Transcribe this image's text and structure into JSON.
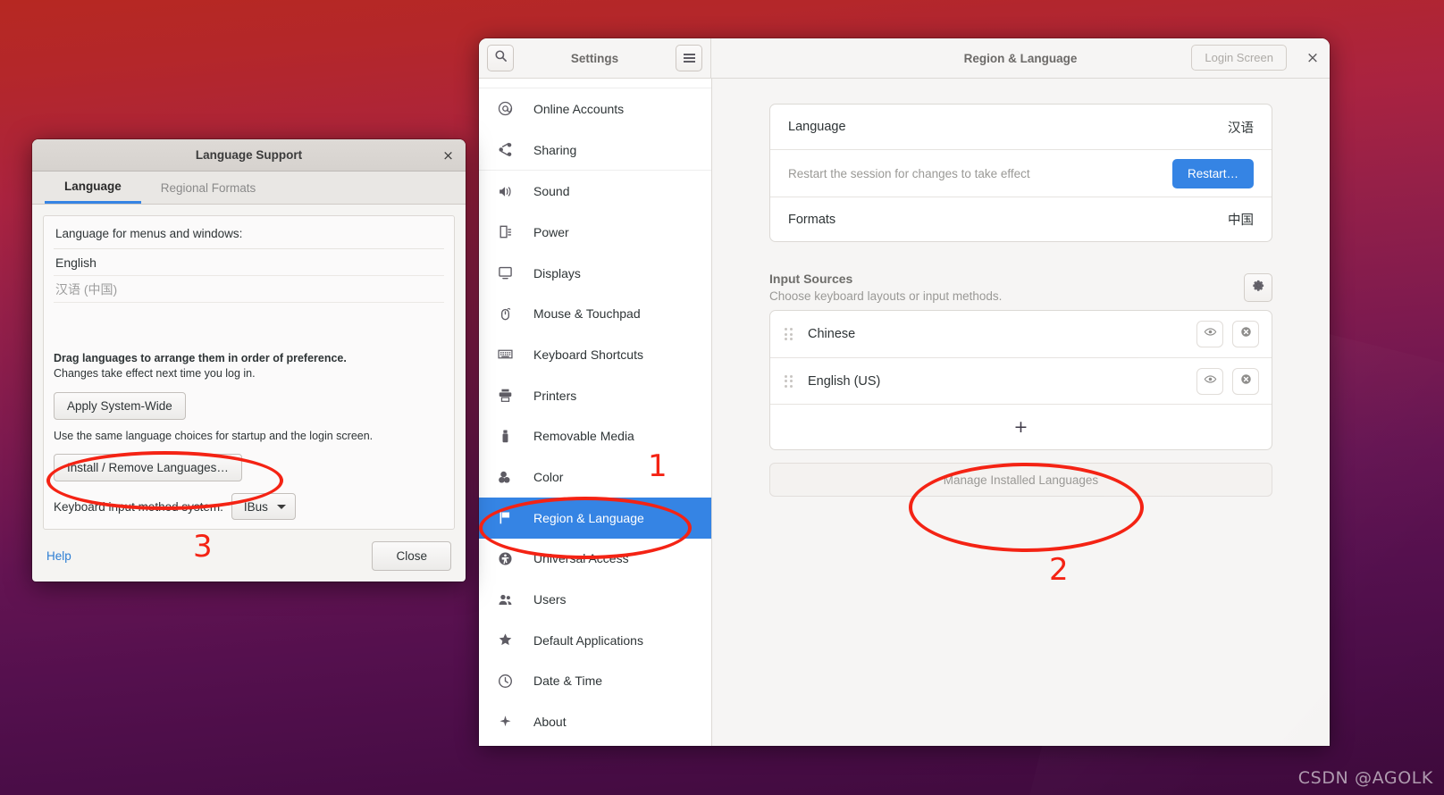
{
  "desktop": {
    "watermark": "CSDN @AGOLK"
  },
  "settings_window": {
    "sidebar_header": {
      "title": "Settings",
      "search_icon": "search-icon",
      "menu_icon": "hamburger-menu-icon"
    },
    "header": {
      "title": "Region & Language",
      "login_screen_label": "Login Screen",
      "close_label": "×"
    },
    "sidebar_items": [
      {
        "label": "Online Accounts",
        "icon": "at-sign-icon",
        "selected": false
      },
      {
        "label": "Sharing",
        "icon": "share-nodes-icon",
        "selected": false
      },
      {
        "label": "Sound",
        "icon": "speaker-icon",
        "selected": false
      },
      {
        "label": "Power",
        "icon": "power-plug-icon",
        "selected": false
      },
      {
        "label": "Displays",
        "icon": "monitor-icon",
        "selected": false
      },
      {
        "label": "Mouse & Touchpad",
        "icon": "mouse-icon",
        "selected": false
      },
      {
        "label": "Keyboard Shortcuts",
        "icon": "keyboard-icon",
        "selected": false
      },
      {
        "label": "Printers",
        "icon": "printer-icon",
        "selected": false
      },
      {
        "label": "Removable Media",
        "icon": "usb-drive-icon",
        "selected": false
      },
      {
        "label": "Color",
        "icon": "color-palette-icon",
        "selected": false
      },
      {
        "label": "Region & Language",
        "icon": "flag-icon",
        "selected": true
      },
      {
        "label": "Universal Access",
        "icon": "accessibility-icon",
        "selected": false
      },
      {
        "label": "Users",
        "icon": "users-icon",
        "selected": false
      },
      {
        "label": "Default Applications",
        "icon": "star-icon",
        "selected": false
      },
      {
        "label": "Date & Time",
        "icon": "clock-icon",
        "selected": false
      },
      {
        "label": "About",
        "icon": "sparkle-icon",
        "selected": false
      }
    ],
    "language_card": {
      "language_label": "Language",
      "language_value": "汉语",
      "restart_hint": "Restart the session for changes to take effect",
      "restart_button": "Restart…",
      "formats_label": "Formats",
      "formats_value": "中国"
    },
    "input_sources": {
      "title": "Input Sources",
      "subtitle": "Choose keyboard layouts or input methods.",
      "settings_icon": "gear-icon",
      "items": [
        {
          "name": "Chinese",
          "preview_icon": "eye-icon",
          "remove_icon": "remove-circle-icon"
        },
        {
          "name": "English (US)",
          "preview_icon": "eye-icon",
          "remove_icon": "remove-circle-icon"
        }
      ],
      "add_label": "+",
      "manage_button": "Manage Installed Languages"
    }
  },
  "language_dialog": {
    "title": "Language Support",
    "close_label": "×",
    "tabs": [
      {
        "label": "Language",
        "active": true
      },
      {
        "label": "Regional Formats",
        "active": false
      }
    ],
    "list_label": "Language for menus and windows:",
    "languages": [
      {
        "label": "English",
        "muted": false
      },
      {
        "label": "汉语 (中国)",
        "muted": true
      }
    ],
    "hint_bold": "Drag languages to arrange them in order of preference.",
    "hint_normal": "Changes take effect next time you log in.",
    "apply_button": "Apply System-Wide",
    "apply_hint": "Use the same language choices for startup and the login screen.",
    "install_button": "Install / Remove Languages…",
    "keyboard_label": "Keyboard input method system:",
    "keyboard_value": "IBus",
    "help_link": "Help",
    "close_button": "Close"
  },
  "annotations": {
    "color": "#f42314",
    "markers": [
      {
        "label": "1",
        "target": "sidebar-item-region-language"
      },
      {
        "label": "2",
        "target": "manage-installed-languages-button"
      },
      {
        "label": "3",
        "target": "install-remove-languages-button"
      }
    ]
  }
}
